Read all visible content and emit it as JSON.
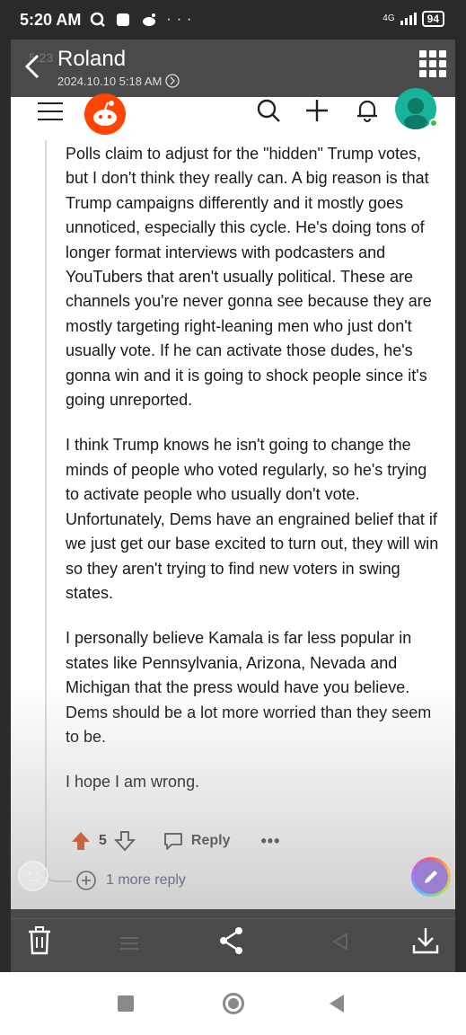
{
  "status_bar": {
    "time": "5:20 AM",
    "network": "4G",
    "battery": "94"
  },
  "viewer": {
    "ghost_time": "5:23",
    "title": "Roland",
    "date": "2024.10.10 5:18 AM"
  },
  "comment": {
    "paragraphs": [
      "Polls claim to adjust for the \"hidden\" Trump votes, but I don't think they really can. A big reason is that Trump campaigns differently and it mostly goes unnoticed, especially this cycle. He's doing tons of longer format interviews with podcasters and YouTubers that aren't usually political. These are channels you're never gonna see because they are mostly targeting right-leaning men who just don't usually vote. If he can activate those dudes, he's gonna win and it is going to shock people since it's going unreported.",
      "I think Trump knows he isn't going to change the minds of people who voted regularly, so he's trying to activate people who usually don't vote. Unfortunately, Dems have an engrained belief that if we just get our base excited to turn out, they will win so they aren't trying to find new voters in swing states.",
      "I personally believe Kamala is far less popular in states like Pennsylvania, Arizona, Nevada and Michigan that the press would have you believe. Dems should be a lot more worried than they seem to be.",
      "I hope I am wrong."
    ],
    "vote_count": "5",
    "reply_label": "Reply",
    "more_label": "•••",
    "more_replies": "1 more reply"
  },
  "icons": {
    "back": "chevron-left-icon",
    "grid": "grid-icon",
    "menu": "hamburger-icon",
    "logo": "reddit-logo",
    "search": "search-icon",
    "add": "plus-icon",
    "notifications": "bell-icon",
    "avatar": "avatar",
    "upvote": "arrow-up-icon",
    "downvote": "arrow-down-icon",
    "reply": "speech-bubble-icon",
    "expand": "plus-circle-icon",
    "delete": "trash-icon",
    "share": "share-icon",
    "download": "download-icon"
  },
  "colors": {
    "upvote": "#d93a00",
    "reddit_orange": "#ff4500",
    "avatar_teal": "#18b39b",
    "link": "#2a3f68"
  }
}
